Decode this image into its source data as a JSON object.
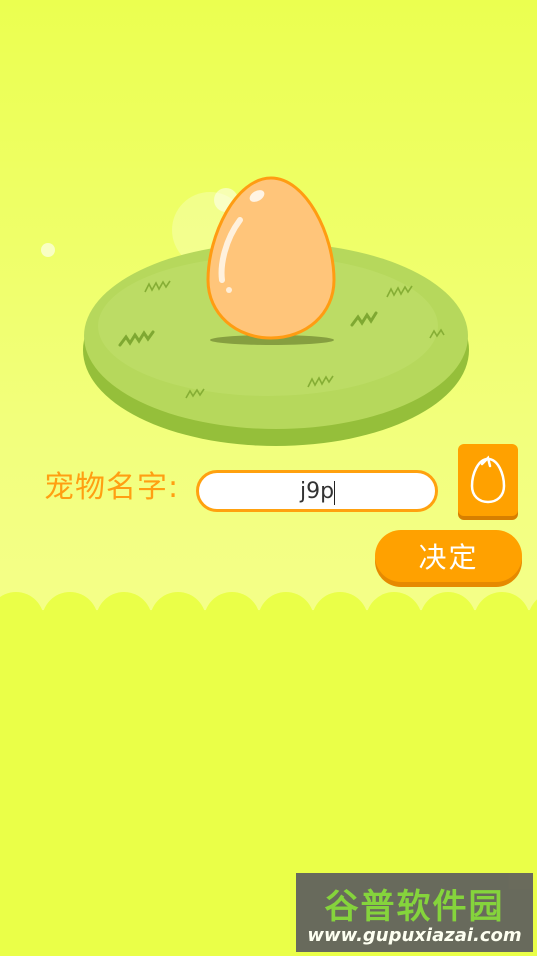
{
  "pet_name_label": "宠物名字:",
  "name_input": {
    "value": "j9p",
    "placeholder": ""
  },
  "confirm_button_label": "决定",
  "colors": {
    "background": "#eaff50",
    "accent": "#ffa100",
    "grass": "#a9d24e",
    "egg": "#ffc57a",
    "egg_outline": "#ff9c12"
  },
  "icons": {
    "random_button": "egg-outline-icon"
  },
  "watermark": {
    "title": "谷普软件园",
    "url": "www.gupuxiazai.com"
  }
}
